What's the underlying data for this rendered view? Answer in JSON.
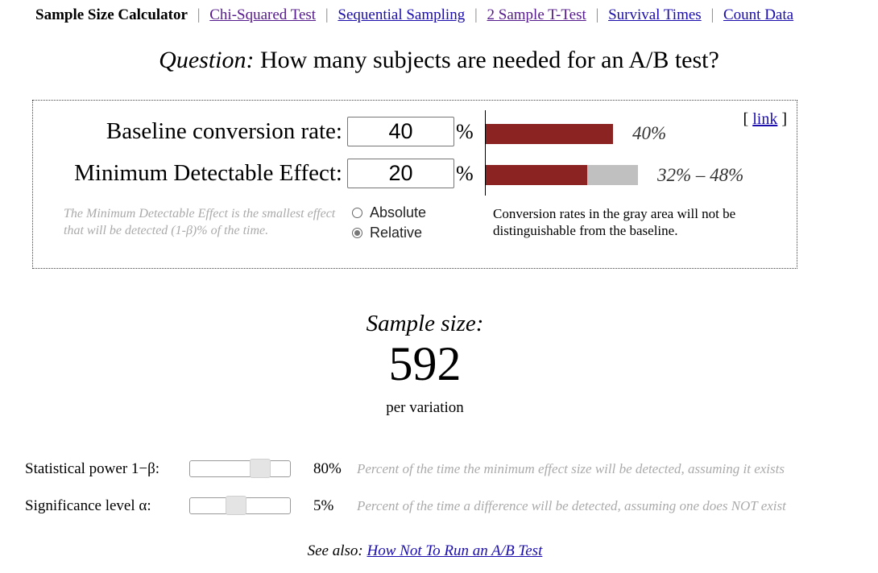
{
  "nav": {
    "title": "Sample Size Calculator",
    "links": [
      "Chi-Squared Test",
      "Sequential Sampling",
      "2 Sample T-Test",
      "Survival Times",
      "Count Data"
    ]
  },
  "question": {
    "label": "Question:",
    "text": "How many subjects are needed for an A/B test?"
  },
  "panel": {
    "link_text": "link",
    "baseline": {
      "label": "Baseline conversion rate:",
      "value": "40",
      "unit": "%",
      "bar_text": "40%",
      "bar_fraction": 0.4
    },
    "mde": {
      "label": "Minimum Detectable Effect:",
      "value": "20",
      "unit": "%",
      "range_text": "32% – 48%",
      "range_low": 0.32,
      "range_high": 0.48
    },
    "hint": "The Minimum Detectable Effect is the smallest effect that will be detected (1-β)% of the time.",
    "mode_options": [
      "Absolute",
      "Relative"
    ],
    "mode_selected": "Relative",
    "gray_note": "Conversion rates in the gray area will not be distinguishable from the baseline."
  },
  "result": {
    "label": "Sample size:",
    "value": "592",
    "unit": "per variation"
  },
  "power": {
    "label": "Statistical power 1−β:",
    "value": "80%",
    "level": 0.8,
    "desc": "Percent of the time the minimum effect size will be detected, assuming it exists"
  },
  "significance": {
    "label": "Significance level α:",
    "value": "5%",
    "level": 0.05,
    "desc": "Percent of the time a difference will be detected, assuming one does NOT exist"
  },
  "see_also": {
    "label": "See also:",
    "link": "How Not To Run an A/B Test"
  },
  "colors": {
    "bar_red": "#8b2323",
    "bar_gray": "#c0c0c0",
    "link": "#1a0dab",
    "visited_link": "#551a8b"
  }
}
